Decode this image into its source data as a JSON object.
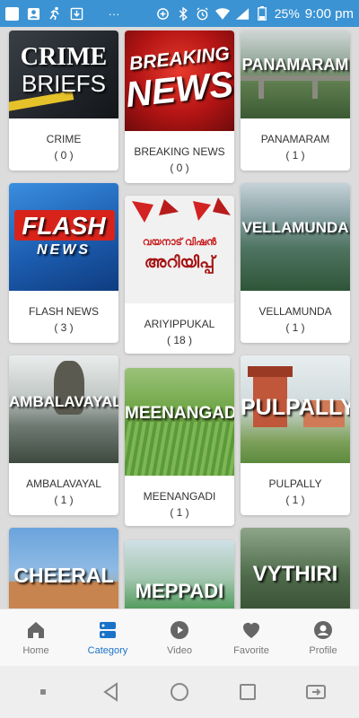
{
  "status_bar": {
    "battery": "25%",
    "time": "9:00 pm",
    "icons": [
      "notification-icon",
      "contacts-icon",
      "runner-icon",
      "download-icon",
      "more-icon",
      "data-saver-icon",
      "bluetooth-icon",
      "alarm-icon",
      "wifi-icon",
      "signal-icon",
      "battery-icon"
    ]
  },
  "categories": [
    {
      "name": "CRIME",
      "count": "( 0 )",
      "thumb_line1": "CRIME",
      "thumb_line2": "BRIEFS",
      "bg": "#2b2f36"
    },
    {
      "name": "BREAKING NEWS",
      "count": "( 0 )",
      "thumb_line1": "BREAKING",
      "thumb_line2": "NEWS",
      "bg": "#c31a1a"
    },
    {
      "name": "PANAMARAM",
      "count": "( 1 )",
      "thumb_line1": "PANAMARAM",
      "thumb_line2": "",
      "bg": "#6d8a5a"
    },
    {
      "name": "FLASH NEWS",
      "count": "( 3 )",
      "thumb_line1": "FLASH",
      "thumb_line2": "NEWS",
      "bg": "#1f5fae"
    },
    {
      "name": "ARIYIPPUKAL",
      "count": "( 18 )",
      "thumb_line1": "വയനാട് വിഷൻ",
      "thumb_line2": "അറിയിപ്പ്",
      "bg": "#f2f2f2"
    },
    {
      "name": "VELLAMUNDA",
      "count": "( 1 )",
      "thumb_line1": "VELLAMUNDA",
      "thumb_line2": "",
      "bg": "#5d7f7a"
    },
    {
      "name": "AMBALAVAYAL",
      "count": "( 1 )",
      "thumb_line1": "AMBALAVAYAL",
      "thumb_line2": "",
      "bg": "#7d8a86"
    },
    {
      "name": "MEENANGADI",
      "count": "( 1 )",
      "thumb_line1": "MEENANGADI",
      "thumb_line2": "",
      "bg": "#4f8a3c"
    },
    {
      "name": "PULPALLY",
      "count": "( 1 )",
      "thumb_line1": "PULPALLY",
      "thumb_line2": "",
      "bg": "#b7684a"
    },
    {
      "name": "CHEERAL",
      "count": "",
      "thumb_line1": "CHEERAL",
      "thumb_line2": "",
      "bg": "#5b8fc2"
    },
    {
      "name": "MEPPADI",
      "count": "",
      "thumb_line1": "MEPPADI",
      "thumb_line2": "",
      "bg": "#3f8a55"
    },
    {
      "name": "VYTHIRI",
      "count": "",
      "thumb_line1": "VYTHIRI",
      "thumb_line2": "",
      "bg": "#3a4a35"
    }
  ],
  "bottom_nav": {
    "items": [
      {
        "label": "Home",
        "icon": "home-icon",
        "active": false
      },
      {
        "label": "Category",
        "icon": "category-icon",
        "active": true
      },
      {
        "label": "Video",
        "icon": "video-icon",
        "active": false
      },
      {
        "label": "Favorite",
        "icon": "heart-icon",
        "active": false
      },
      {
        "label": "Profile",
        "icon": "profile-icon",
        "active": false
      }
    ]
  },
  "colors": {
    "status_bar": "#3b93d3",
    "accent": "#1a73c8",
    "nav_inactive": "#777777"
  }
}
